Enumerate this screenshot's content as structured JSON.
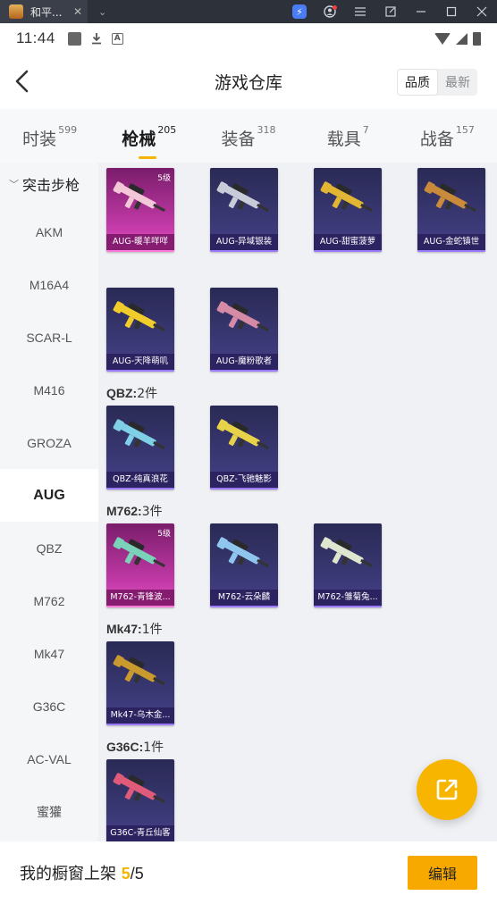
{
  "window": {
    "tab_title": "和平...",
    "close": "✕",
    "chevron": "⌄",
    "controls": [
      "bolt-icon",
      "user-icon",
      "menu-icon",
      "popout-icon",
      "minimize-icon",
      "maximize-icon",
      "close-icon"
    ]
  },
  "status": {
    "time": "11:44"
  },
  "header": {
    "title": "游戏仓库",
    "toggle": [
      {
        "label": "品质",
        "active": true
      },
      {
        "label": "最新",
        "active": false
      }
    ]
  },
  "tabs": [
    {
      "label": "时装",
      "count": "599",
      "active": false
    },
    {
      "label": "枪械",
      "count": "205",
      "active": true
    },
    {
      "label": "装备",
      "count": "318",
      "active": false
    },
    {
      "label": "载具",
      "count": "7",
      "active": false
    },
    {
      "label": "战备",
      "count": "157",
      "active": false
    }
  ],
  "sidebar": {
    "category": "突击步枪",
    "items": [
      {
        "label": "AKM",
        "active": false
      },
      {
        "label": "M16A4",
        "active": false
      },
      {
        "label": "SCAR-L",
        "active": false
      },
      {
        "label": "M416",
        "active": false
      },
      {
        "label": "GROZA",
        "active": false
      },
      {
        "label": "AUG",
        "active": true
      },
      {
        "label": "QBZ",
        "active": false
      },
      {
        "label": "M762",
        "active": false
      },
      {
        "label": "Mk47",
        "active": false
      },
      {
        "label": "G36C",
        "active": false
      },
      {
        "label": "AC-VAL",
        "active": false
      },
      {
        "label": "蜜獾",
        "active": false
      }
    ]
  },
  "groups": [
    {
      "title": "",
      "rows": [
        [
          {
            "name": "AUG-暖羊咩咩",
            "level": "5级",
            "rarity": "legend",
            "color": "#f4c7d8"
          },
          {
            "name": "AUG-异域银装",
            "level": "",
            "rarity": "epic",
            "color": "#c8ccd8"
          },
          {
            "name": "AUG-甜蜜菠萝",
            "level": "",
            "rarity": "epic",
            "color": "#e2b632"
          },
          {
            "name": "AUG-金蛇镇世",
            "level": "",
            "rarity": "epic",
            "color": "#c98a3c"
          }
        ],
        [
          {
            "name": "AUG-天降萌叽",
            "level": "",
            "rarity": "epic",
            "color": "#f2cc2a"
          },
          {
            "name": "AUG-魔粉歌者",
            "level": "",
            "rarity": "epic",
            "color": "#d58aa6"
          }
        ]
      ]
    },
    {
      "title": "QBZ",
      "count": "2件",
      "rows": [
        [
          {
            "name": "QBZ-纯真浪花",
            "level": "",
            "rarity": "epic",
            "color": "#7fd0e6"
          },
          {
            "name": "QBZ-飞驰魅影",
            "level": "",
            "rarity": "epic",
            "color": "#e7d24a"
          }
        ]
      ]
    },
    {
      "title": "M762",
      "count": "3件",
      "rows": [
        [
          {
            "name": "M762-青锋波...",
            "level": "5级",
            "rarity": "legend",
            "color": "#7ad2b8"
          },
          {
            "name": "M762-云朵麟",
            "level": "",
            "rarity": "epic",
            "color": "#8ec6ee"
          },
          {
            "name": "M762-雏菊兔...",
            "level": "",
            "rarity": "epic",
            "color": "#dfe6cf"
          }
        ]
      ]
    },
    {
      "title": "Mk47",
      "count": "1件",
      "rows": [
        [
          {
            "name": "Mk47-乌木金...",
            "level": "",
            "rarity": "epic",
            "color": "#c99a2e"
          }
        ]
      ]
    },
    {
      "title": "G36C",
      "count": "1件",
      "rows": [
        [
          {
            "name": "G36C-青丘仙客",
            "level": "",
            "rarity": "epic",
            "color": "#e05a7a"
          }
        ]
      ]
    }
  ],
  "footer": {
    "text": "我的橱窗上架 ",
    "count": "5",
    "total": "/5",
    "edit_label": "编辑"
  },
  "colors": {
    "accent": "#f5b400",
    "button": "#f7a900"
  }
}
